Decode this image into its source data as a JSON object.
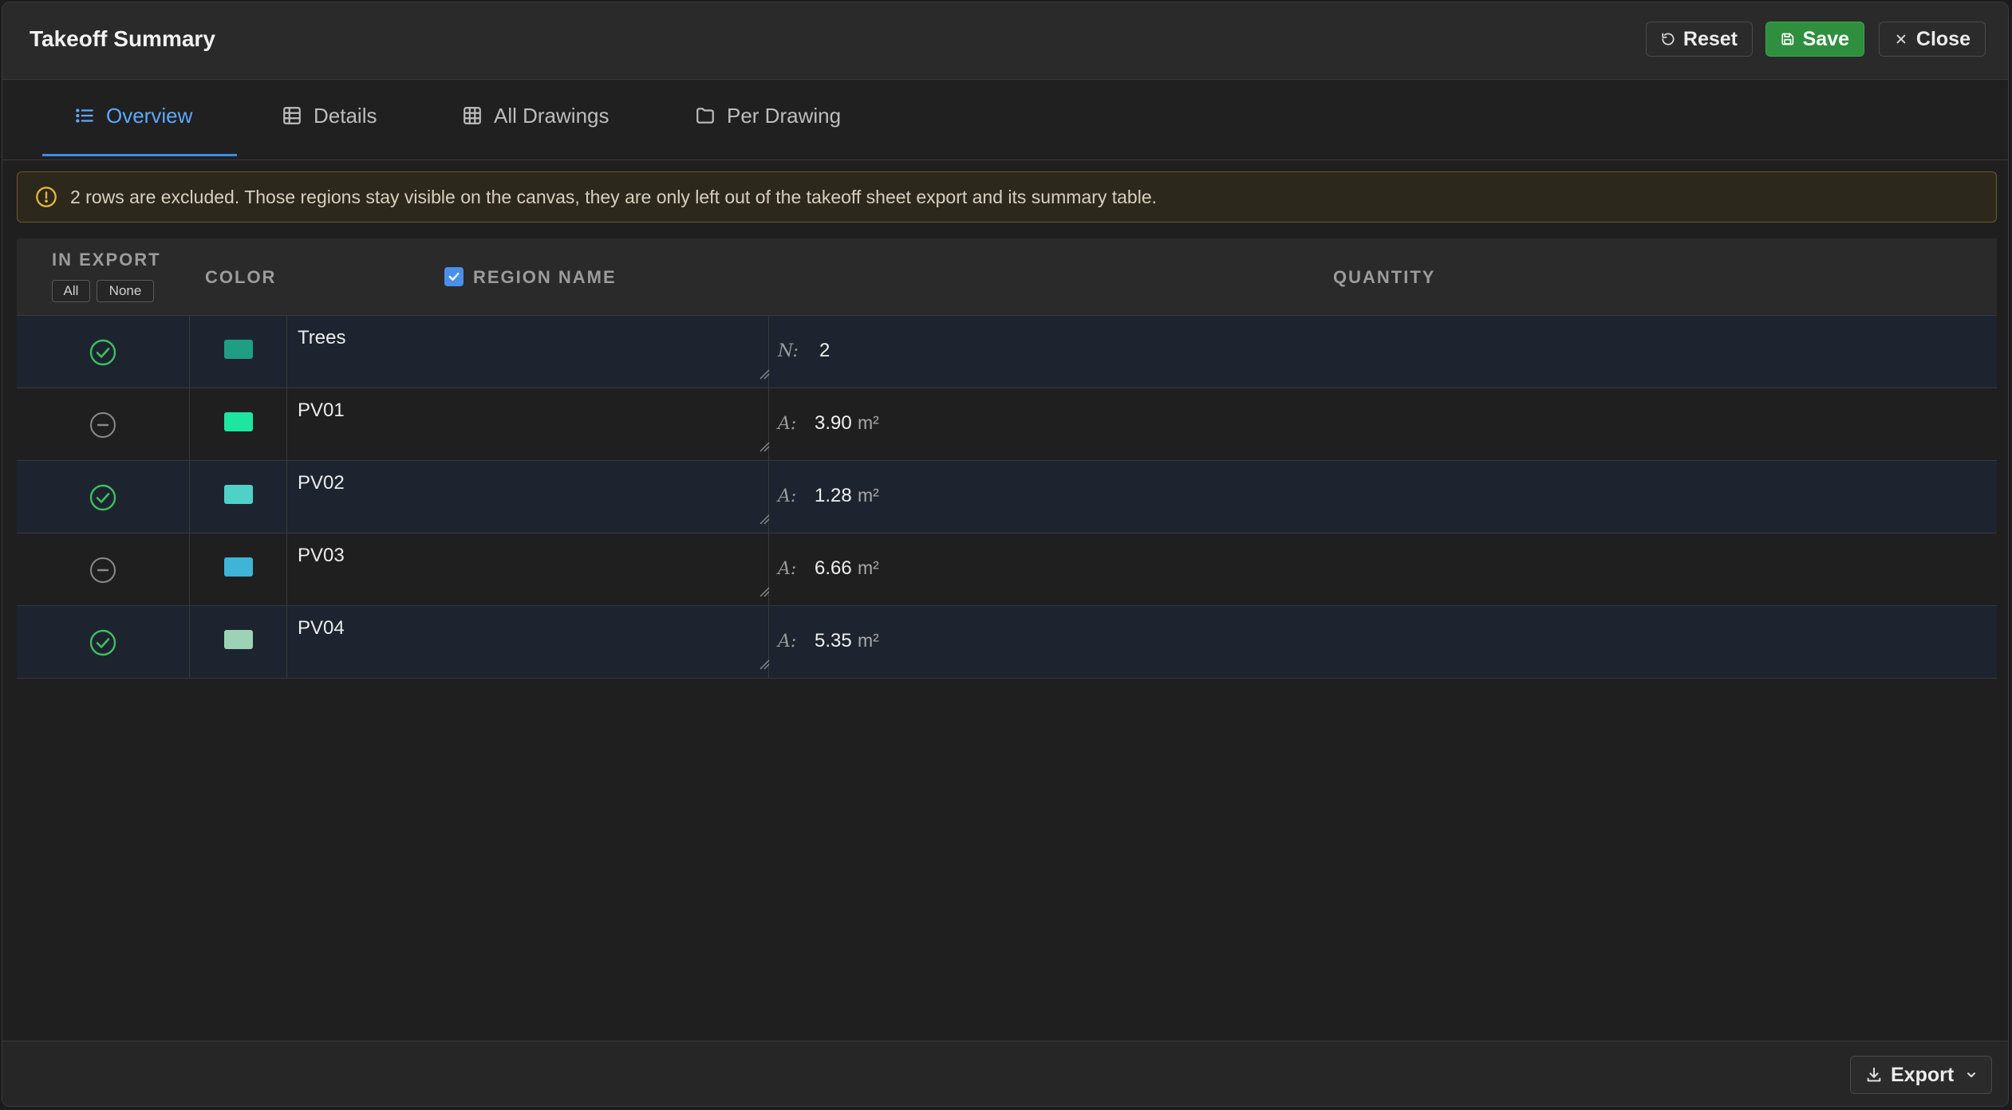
{
  "header": {
    "title": "Takeoff Summary",
    "reset_label": "Reset",
    "save_label": "Save",
    "close_label": "Close"
  },
  "tabs": [
    {
      "label": "Overview",
      "icon": "list-icon",
      "active": true
    },
    {
      "label": "Details",
      "icon": "table-icon",
      "active": false
    },
    {
      "label": "All Drawings",
      "icon": "grid-icon",
      "active": false
    },
    {
      "label": "Per Drawing",
      "icon": "folder-icon",
      "active": false
    }
  ],
  "banner": {
    "text": "2 rows are excluded. Those regions stay visible on the canvas, they are only left out of the takeoff sheet export and its summary table."
  },
  "table": {
    "headers": {
      "in_export": "IN EXPORT",
      "all": "All",
      "none": "None",
      "color": "COLOR",
      "region_name": "REGION NAME",
      "quantity": "QUANTITY"
    },
    "rows": [
      {
        "included": true,
        "color": "#1f9e83",
        "name": "Trees",
        "qlabel": "N:",
        "value": "2",
        "unit": ""
      },
      {
        "included": false,
        "color": "#1de6a0",
        "name": "PV01",
        "qlabel": "A:",
        "value": "3.90",
        "unit": "m²"
      },
      {
        "included": true,
        "color": "#4fd1c8",
        "name": "PV02",
        "qlabel": "A:",
        "value": "1.28",
        "unit": "m²"
      },
      {
        "included": false,
        "color": "#3fb4d6",
        "name": "PV03",
        "qlabel": "A:",
        "value": "6.66",
        "unit": "m²"
      },
      {
        "included": true,
        "color": "#9cd2b5",
        "name": "PV04",
        "qlabel": "A:",
        "value": "5.35",
        "unit": "m²"
      }
    ]
  },
  "colors": {
    "accent": "#3b8cf0",
    "save": "#2f8f3e",
    "included": "#3fbf5f",
    "excluded": "#8a8a8a",
    "warning": "#e0b43c"
  },
  "footer": {
    "export_label": "Export"
  }
}
